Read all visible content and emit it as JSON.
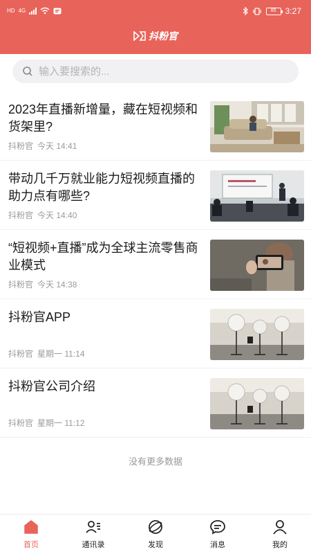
{
  "status_bar": {
    "time": "3:27",
    "network_label": "HD",
    "network_type": "4G",
    "battery_level": "85"
  },
  "header": {
    "brand_name": "抖粉官",
    "color": "#e8635a"
  },
  "search": {
    "placeholder": "输入要搜索的..."
  },
  "articles": [
    {
      "title": "2023年直播新增量，藏在短视频和货架里?",
      "source": "抖粉官",
      "time": "今天 14:41",
      "thumbnail": "living-room-photo"
    },
    {
      "title": "带动几千万就业能力短视频直播的助力点有哪些?",
      "source": "抖粉官",
      "time": "今天 14:40",
      "thumbnail": "meeting-room-photo"
    },
    {
      "title": "“短视频+直播”成为全球主流零售商业模式",
      "source": "抖粉官",
      "time": "今天 14:38",
      "thumbnail": "phone-filming-photo"
    },
    {
      "title": "抖粉官APP",
      "source": "抖粉官",
      "time": "星期一 11:14",
      "thumbnail": "photo-studio-photo"
    },
    {
      "title": "抖粉官公司介绍",
      "source": "抖粉官",
      "time": "星期一 11:12",
      "thumbnail": "photo-studio-photo"
    }
  ],
  "footer_text": "没有更多数据",
  "tabs": [
    {
      "label": "首页",
      "icon": "home-icon",
      "active": true
    },
    {
      "label": "通讯录",
      "icon": "contacts-icon",
      "active": false
    },
    {
      "label": "发现",
      "icon": "discover-icon",
      "active": false
    },
    {
      "label": "消息",
      "icon": "message-icon",
      "active": false
    },
    {
      "label": "我的",
      "icon": "profile-icon",
      "active": false
    }
  ]
}
